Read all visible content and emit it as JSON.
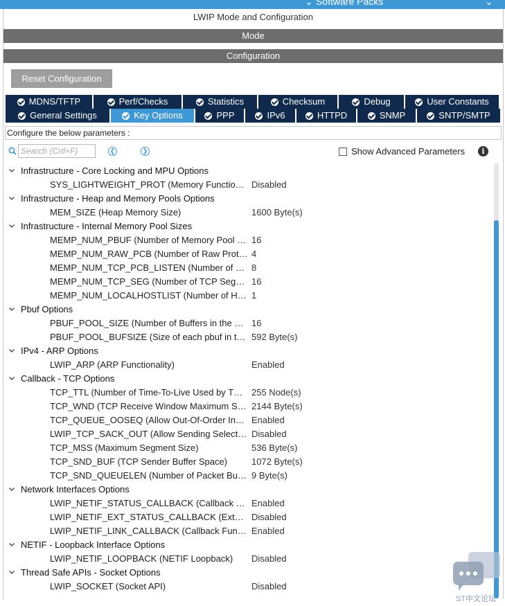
{
  "top": {
    "software_packs": "Software Packs"
  },
  "panel": {
    "title": "LWIP Mode and Configuration",
    "mode_label": "Mode",
    "configuration_label": "Configuration",
    "reset_label": "Reset Configuration"
  },
  "tabs": {
    "row1": [
      {
        "label": "MDNS/TFTP"
      },
      {
        "label": "Perf/Checks"
      },
      {
        "label": "Statistics"
      },
      {
        "label": "Checksum"
      },
      {
        "label": "Debug"
      },
      {
        "label": "User Constants"
      }
    ],
    "row2": [
      {
        "label": "General Settings"
      },
      {
        "label": "Key Options"
      },
      {
        "label": "PPP"
      },
      {
        "label": "IPv6"
      },
      {
        "label": "HTTPD"
      },
      {
        "label": "SNMP"
      },
      {
        "label": "SNTP/SMTP"
      }
    ]
  },
  "configure_text": "Configure the below parameters :",
  "search": {
    "placeholder": "Search (Crtl+F)"
  },
  "advanced_label": "Show Advanced Parameters",
  "tree": {
    "g1": "Infrastructure - Core Locking and MPU Options",
    "g1p1": {
      "name": "SYS_LIGHTWEIGHT_PROT (Memory Functions Protection)",
      "value": "Disabled"
    },
    "g2": "Infrastructure - Heap and Memory Pools Options",
    "g2p1": {
      "name": "MEM_SIZE (Heap Memory Size)",
      "value": "1600 Byte(s)"
    },
    "g3": "Infrastructure - Internal Memory Pool Sizes",
    "g3p1": {
      "name": "MEMP_NUM_PBUF (Number of Memory Pool struct pbufs)",
      "value": "16"
    },
    "g3p2": {
      "name": "MEMP_NUM_RAW_PCB (Number of Raw Protocol Control Blocks)",
      "value": "4"
    },
    "g3p3": {
      "name": "MEMP_NUM_TCP_PCB_LISTEN (Number of Listening TCP Connections)",
      "value": "8"
    },
    "g3p4": {
      "name": "MEMP_NUM_TCP_SEG (Number of TCP Segments)",
      "value": "16"
    },
    "g3p5": {
      "name": "MEMP_NUM_LOCALHOSTLIST (Number of Host IP Addresses)",
      "value": "1"
    },
    "g4": "Pbuf Options",
    "g4p1": {
      "name": "PBUF_POOL_SIZE (Number of Buffers in the Pbuf Pool)",
      "value": "16"
    },
    "g4p2": {
      "name": "PBUF_POOL_BUFSIZE (Size of each pbuf in the Pbuf Pool)",
      "value": "592 Byte(s)"
    },
    "g5": "IPv4 - ARP Options",
    "g5p1": {
      "name": "LWIP_ARP (ARP Functionality)",
      "value": "Enabled"
    },
    "g6": "Callback - TCP Options",
    "g6p1": {
      "name": "TCP_TTL (Number of Time-To-Live Used by TCP Packets)",
      "value": "255 Node(s)"
    },
    "g6p2": {
      "name": "TCP_WND (TCP Receive Window Maximum Size)",
      "value": "2144 Byte(s)"
    },
    "g6p3": {
      "name": "TCP_QUEUE_OOSEQ (Allow Out-Of-Order Incoming Packets)",
      "value": "Enabled"
    },
    "g6p4": {
      "name": "LWIP_TCP_SACK_OUT (Allow Sending Selective Acknowledgements)",
      "value": "Disabled"
    },
    "g6p5": {
      "name": "TCP_MSS (Maximum Segment Size)",
      "value": "536 Byte(s)"
    },
    "g6p6": {
      "name": "TCP_SND_BUF (TCP Sender Buffer Space)",
      "value": "1072 Byte(s)"
    },
    "g6p7": {
      "name": "TCP_SND_QUEUELEN (Number of Packet Buffers Allowed)",
      "value": "9 Byte(s)"
    },
    "g7": "Network Interfaces Options",
    "g7p1": {
      "name": "LWIP_NETIF_STATUS_CALLBACK (Callback Function on Interface Status Changes)",
      "value": "Enabled"
    },
    "g7p2": {
      "name": "LWIP_NETIF_EXT_STATUS_CALLBACK (Extended Callback Function)",
      "value": "Disabled"
    },
    "g7p3": {
      "name": "LWIP_NETIF_LINK_CALLBACK (Callback Function on Interface Link Changes)",
      "value": "Enabled"
    },
    "g8": "NETIF - Loopback Interface Options",
    "g8p1": {
      "name": "LWIP_NETIF_LOOPBACK (NETIF Loopback)",
      "value": "Disabled"
    },
    "g9": "Thread Safe APIs - Socket Options",
    "g9p1": {
      "name": "LWIP_SOCKET (Socket API)",
      "value": "Disabled"
    }
  },
  "watermark": {
    "text": "ST中文论坛"
  },
  "colors": {
    "tab_dark": "#0f2a4c",
    "tab_active": "#3f98d6",
    "bar_gray": "#6d6d6d",
    "scroll_thumb": "#3f98d6"
  },
  "icons": {
    "tab": "check-circle-icon",
    "search": "search-icon",
    "prev": "chevron-left-icon",
    "next": "chevron-right-icon",
    "group": "caret-down-icon",
    "info": "info-icon"
  }
}
